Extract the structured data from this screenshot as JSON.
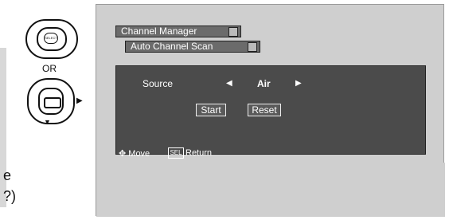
{
  "remote": {
    "select_label": "SELECT",
    "or_label": "OR",
    "cut_text_1": "e",
    "cut_text_2": "?)"
  },
  "menu": {
    "tabs": [
      {
        "label": "Channel Manager"
      },
      {
        "label": "Auto Channel Scan"
      }
    ],
    "source": {
      "label": "Source",
      "value": "Air"
    },
    "buttons": {
      "start": "Start",
      "reset": "Reset"
    },
    "hint": {
      "move": "Move",
      "sel": "SEL",
      "return": "Return"
    }
  }
}
